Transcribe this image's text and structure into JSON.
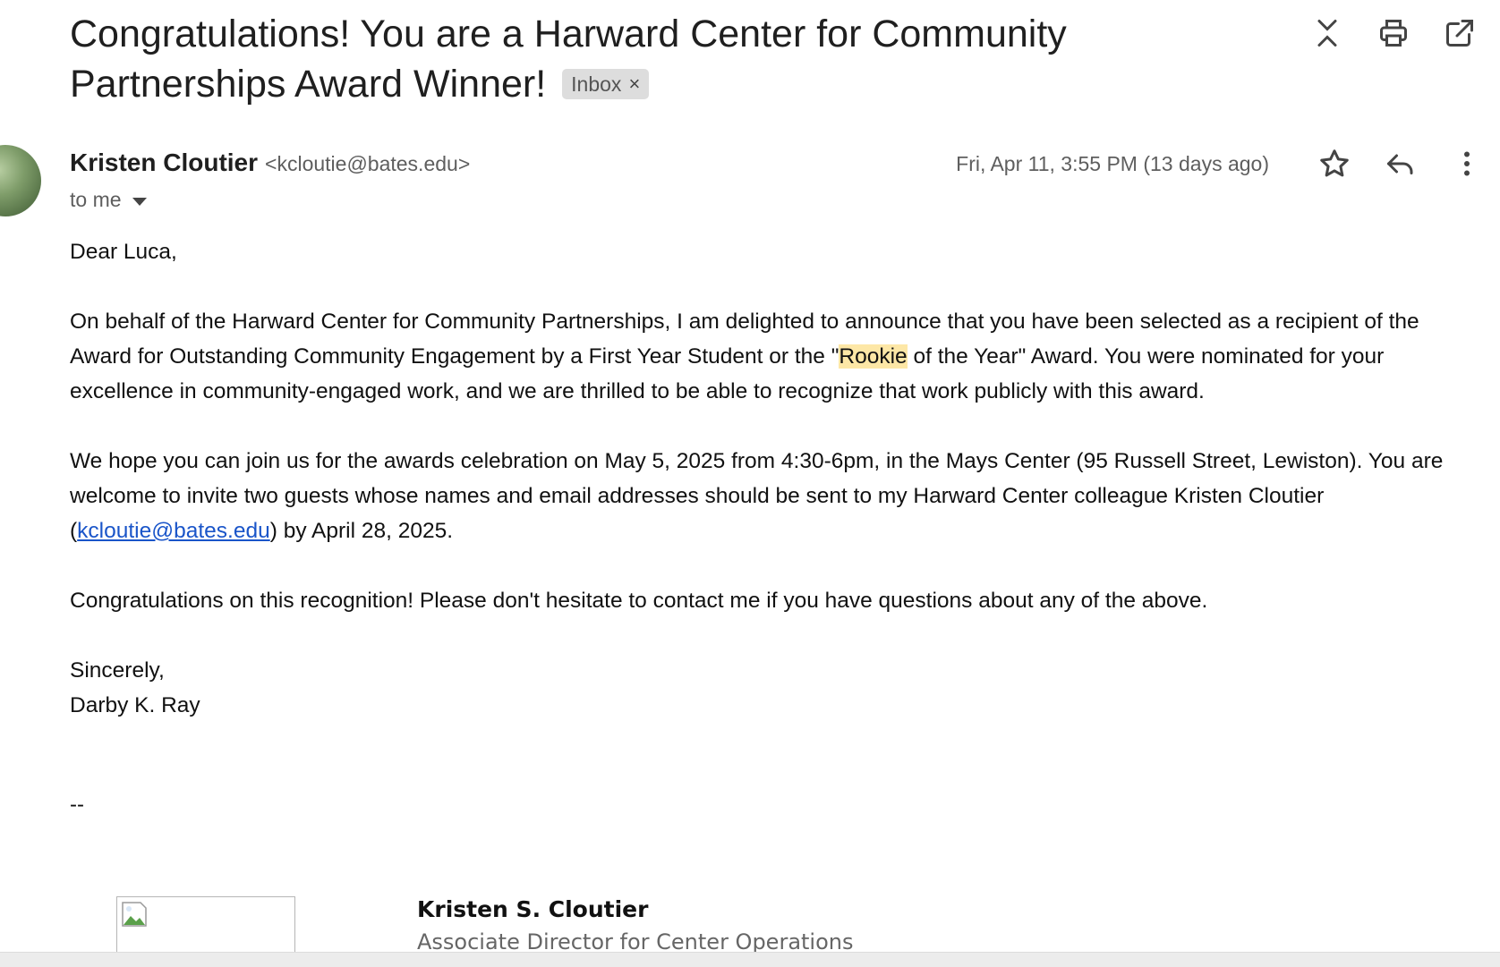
{
  "header": {
    "subject": "Congratulations! You are a Harward Center for Community Partnerships Award Winner!",
    "label_chip": "Inbox",
    "label_remove": "×",
    "icons": [
      "collapse-icon",
      "print-icon",
      "open-in-new-window-icon"
    ]
  },
  "message": {
    "sender_name": "Kristen Cloutier",
    "sender_email": "<kcloutie@bates.edu>",
    "recipient": "to me",
    "date": "Fri, Apr 11, 3:55 PM (13 days ago)",
    "icons": [
      "star-icon",
      "reply-icon",
      "more-vert-icon"
    ]
  },
  "body": {
    "greeting": "Dear Luca,",
    "p1_before": "On behalf of the Harward Center for Community Partnerships, I am delighted to announce that you have been selected as a recipient of the Award for Outstanding Community Engagement by a First Year Student or the \"",
    "p1_highlight": "Rookie",
    "p1_after": " of the Year\" Award. You were nominated for your excellence in community-engaged work, and we are thrilled to be able to recognize that work publicly with this award.",
    "p2_before": "We hope you can join us for the awards celebration on May 5, 2025 from 4:30-6pm, in the Mays Center (95 Russell Street, Lewiston). You are welcome to invite two guests whose names and email addresses should be sent to my Harward Center colleague Kristen Cloutier (",
    "p2_link": "kcloutie@bates.edu",
    "p2_after": ") by April 28, 2025.",
    "p3": "Congratulations on this recognition! Please don't hesitate to contact me if you have questions about any of the above.",
    "closing": "Sincerely,",
    "closing_name": "Darby K. Ray",
    "sig_separator": "--"
  },
  "signature": {
    "name": "Kristen S. Cloutier",
    "title": "Associate Director for Center Operations"
  },
  "colors": {
    "highlight": "#fde7a6",
    "link": "#1a55c9",
    "chip_bg": "#dddddd"
  }
}
